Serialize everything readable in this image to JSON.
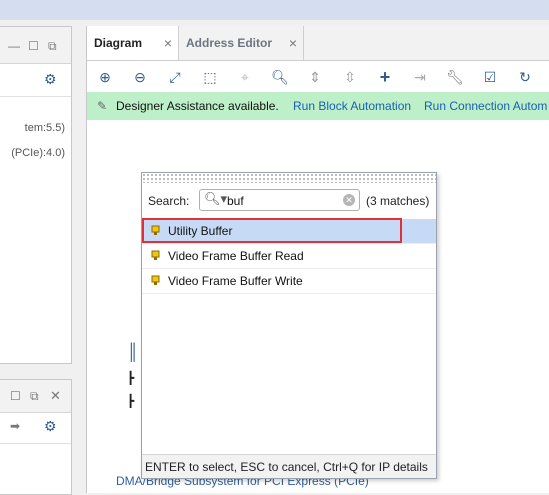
{
  "left_panel": {
    "lines": [
      "tem:5.5)",
      "(PCIe):4.0)"
    ]
  },
  "main": {
    "tabs": [
      {
        "label": "Diagram"
      },
      {
        "label": "Address Editor"
      }
    ],
    "assist": {
      "message": "Designer Assistance available.",
      "link1": "Run Block Automation",
      "link2": "Run Connection Autom"
    },
    "canvas_text": "DMA/Bridge Subsystem for PCI Express (PCIe)"
  },
  "popup": {
    "search_label": "Search:",
    "search_value": "buf",
    "matches": "(3 matches)",
    "results": [
      {
        "label": "Utility Buffer",
        "selected": true
      },
      {
        "label": "Video Frame Buffer Read",
        "selected": false
      },
      {
        "label": "Video Frame Buffer Write",
        "selected": false
      }
    ],
    "footer": "ENTER to select, ESC to cancel, Ctrl+Q for IP details"
  },
  "colors": {
    "assist_bg": "#bdf0c8",
    "selection": "#c7daf5",
    "highlight": "#e0303a",
    "link": "#1a5fb4"
  }
}
